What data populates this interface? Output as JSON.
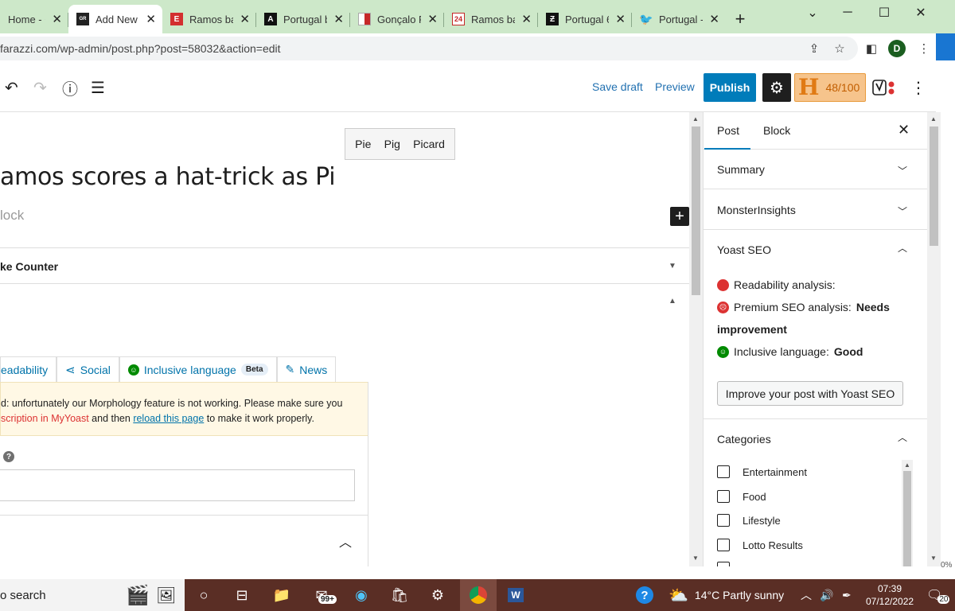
{
  "browser": {
    "tabs": [
      {
        "label": "Home - C",
        "favicon": "home-favicon",
        "active": false
      },
      {
        "label": "Add New",
        "favicon": "site-favicon",
        "active": true
      },
      {
        "label": "Ramos ba",
        "favicon": "e-favicon",
        "active": false
      },
      {
        "label": "Portugal b",
        "favicon": "a-favicon",
        "active": false
      },
      {
        "label": "Gonçalo R",
        "favicon": "flag-favicon",
        "active": false
      },
      {
        "label": "Ramos ba",
        "favicon": "24-favicon",
        "active": false
      },
      {
        "label": "Portugal 6",
        "favicon": "z-favicon",
        "active": false
      },
      {
        "label": "Portugal -",
        "favicon": "twitter-favicon",
        "active": false
      }
    ],
    "new_tab": "+",
    "url": "farazzi.com/wp-admin/post.php?post=58032&action=edit",
    "profile_initial": "D"
  },
  "editor_header": {
    "save_draft": "Save draft",
    "preview": "Preview",
    "publish": "Publish",
    "score": "48/100",
    "score_letter": "H"
  },
  "canvas": {
    "suggestions": [
      "Pie",
      "Pig",
      "Picard"
    ],
    "title": "amos scores a hat-trick as Pi",
    "placeholder": "lock",
    "panel1": "ke Counter",
    "tabs": {
      "readability": "eadability",
      "social": "Social",
      "inclusive": "Inclusive language",
      "beta": "Beta",
      "news": "News"
    },
    "notice": {
      "line1": "d: unfortunately our Morphology feature is not working. Please make sure you",
      "red": "scription in MyYoast",
      "mid": " and then ",
      "link": "reload this page",
      "tail": " to make it work properly."
    },
    "help": "?"
  },
  "sidebar": {
    "tab_post": "Post",
    "tab_block": "Block",
    "summary": "Summary",
    "monsterinsights": "MonsterInsights",
    "yoast": "Yoast SEO",
    "readability": "Readability analysis:",
    "premium_label": "Premium SEO analysis: ",
    "premium_value": "Needs",
    "premium_value2": "improvement",
    "inclusive_label": "Inclusive language: ",
    "inclusive_value": "Good",
    "improve_button": "Improve your post with Yoast SEO",
    "categories": "Categories",
    "category_items": [
      "Entertainment",
      "Food",
      "Lifestyle",
      "Lotto Results"
    ],
    "zoom_edge": "0%"
  },
  "taskbar": {
    "search": "o search",
    "mail_badge": "99+",
    "weather": "14°C  Partly sunny",
    "time": "07:39",
    "date": "07/12/2022",
    "notifications": "20"
  },
  "colors": {
    "tabstrip": "#cde8c9",
    "wp_blue": "#007cba",
    "yoast_red": "#dc3232",
    "yoast_green": "#008a00",
    "taskbar": "#5a2e25"
  }
}
